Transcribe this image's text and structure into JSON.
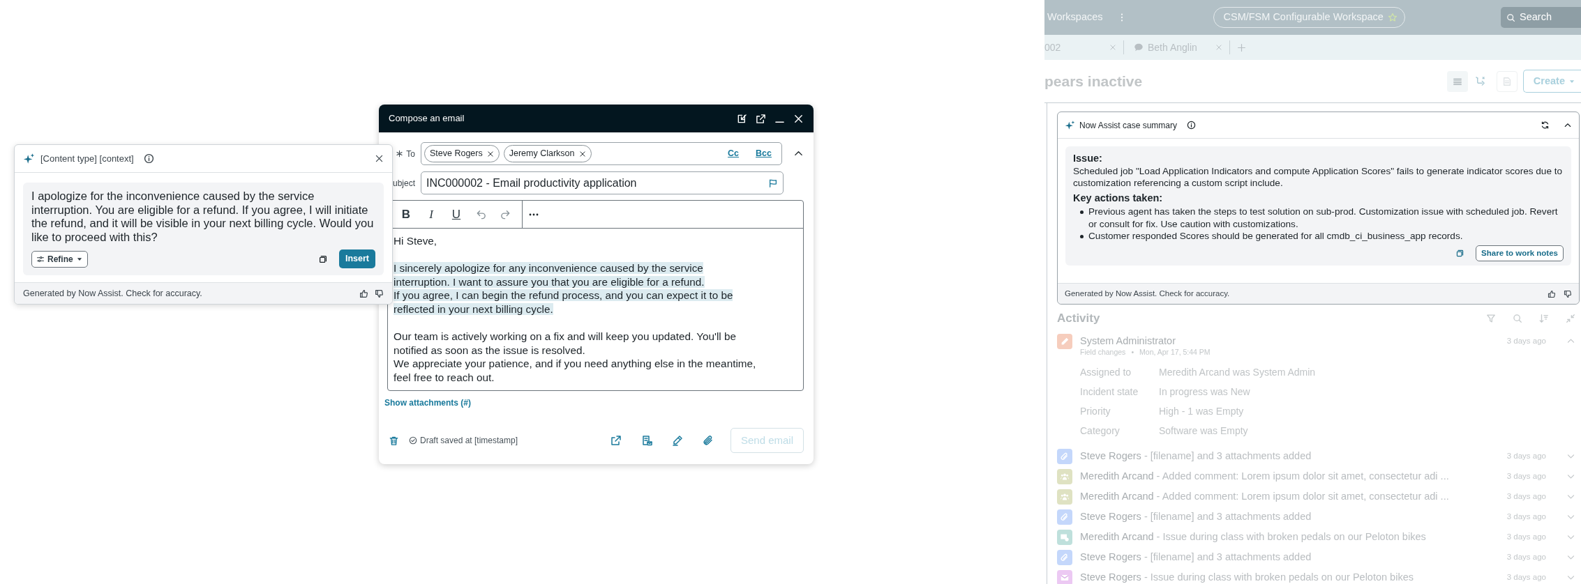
{
  "assist_panel": {
    "title": "[Content type] [context]",
    "body": "I apologize for the inconvenience caused by the service interruption. You are eligible for a refund. If you agree, I will initiate the refund, and it will be visible in your next billing cycle. Would you like to proceed with this?",
    "refine_label": "Refine",
    "insert_label": "Insert",
    "footer": "Generated by Now Assist. Check for accuracy."
  },
  "compose": {
    "title": "Compose an email",
    "to_label": "To",
    "recipients": [
      "Steve Rogers",
      "Jeremy Clarkson"
    ],
    "cc_label": "Cc",
    "bcc_label": "Bcc",
    "subject_label": "ubject",
    "subject": "INC000002 - Email productivity application",
    "format_buttons": [
      {
        "label": "B",
        "kind": "bold"
      },
      {
        "label": "I",
        "kind": "italic"
      },
      {
        "label": "U",
        "kind": "underline"
      }
    ],
    "paragraphs": [
      {
        "highlighted": false,
        "lines": [
          "Hi Steve,"
        ]
      },
      {
        "highlighted": true,
        "lines": [
          "I sincerely apologize for any inconvenience caused by the service",
          "interruption. I want to assure you that you are eligible for a refund.",
          "If you agree, I can begin the refund process, and you can expect it to be",
          "reflected in your next billing cycle."
        ]
      },
      {
        "highlighted": false,
        "lines": [
          "Our team is actively working on a fix and will keep you updated. You'll be",
          "notified as soon as the issue is resolved.",
          "We appreciate your patience, and if you need anything else in the meantime,",
          "feel free to reach out."
        ]
      }
    ],
    "attachments_link": "Show attachments (#)",
    "draft_status": "Draft saved at [timestamp]",
    "send_label": "Send email",
    "send_disabled": true
  },
  "workspace": {
    "menu_label": "Workspaces",
    "workspace_name": "CSM/FSM Configurable Workspace",
    "search_placeholder": "Search",
    "tabs": [
      {
        "label": "002",
        "kind": "record"
      },
      {
        "label": "Beth Anglin",
        "kind": "chat"
      }
    ],
    "heading": "pears inactive",
    "create_label": "Create",
    "summary": {
      "title": "Now Assist case summary",
      "issue_heading": "Issue:",
      "issue_text": "Scheduled job \"Load Application Indicators and compute Application Scores\" fails to generate indicator scores due to customization referencing a custom script include.",
      "actions_heading": "Key actions taken:",
      "actions": [
        "Previous agent has taken the steps to test solution on sub-prod. Customization issue with scheduled job. Revert or consult for fix. Use caution with customizations.",
        "Customer responded Scores should be generated for all cmdb_ci_business_app records."
      ],
      "share_label": "Share to work notes",
      "footer": "Generated by Now Assist. Check for accuracy."
    },
    "activity": {
      "title": "Activity",
      "entries": [
        {
          "kind": "field-change",
          "author": "System Administrator",
          "meta_type": "Field changes",
          "meta_separator": "•",
          "meta_date": "Mon, Apr 17, 5:44 PM",
          "time": "3 days ago",
          "expanded": true,
          "changes": [
            {
              "field": "Assigned to",
              "value": "Meredith Arcand was System Admin"
            },
            {
              "field": "Incident state",
              "value": "In progress was New"
            },
            {
              "field": "Priority",
              "value": "High - 1 was Empty"
            },
            {
              "field": "Category",
              "value": "Software was Empty"
            }
          ]
        },
        {
          "kind": "attachment",
          "author": "Steve Rogers",
          "text": " - [filename] and 3 attachments added",
          "time": "3 days ago",
          "expanded": false
        },
        {
          "kind": "comment",
          "author": "Meredith Arcand",
          "text": " - Added comment: Lorem ipsum dolor sit amet, consectetur adi ...",
          "time": "3 days ago",
          "expanded": false
        },
        {
          "kind": "comment",
          "author": "Meredith Arcand",
          "text": " - Added comment: Lorem ipsum dolor sit amet, consectetur adi ...",
          "time": "3 days ago",
          "expanded": false
        },
        {
          "kind": "attachment",
          "author": "Steve Rogers",
          "text": " - [filename] and 3 attachments added",
          "time": "3 days ago",
          "expanded": false
        },
        {
          "kind": "email-sent",
          "author": "Meredith Arcand",
          "text": " - Issue during class with broken pedals on our Peloton bikes",
          "time": "3 days ago",
          "expanded": false
        },
        {
          "kind": "attachment",
          "author": "Steve Rogers",
          "text": " - [filename] and 3 attachments added",
          "time": "3 days ago",
          "expanded": false
        },
        {
          "kind": "email",
          "author": "Steve Rogers",
          "text": " - Issue during class with broken pedals on our Peloton bikes",
          "time": "3 days ago",
          "expanded": false
        }
      ]
    }
  }
}
